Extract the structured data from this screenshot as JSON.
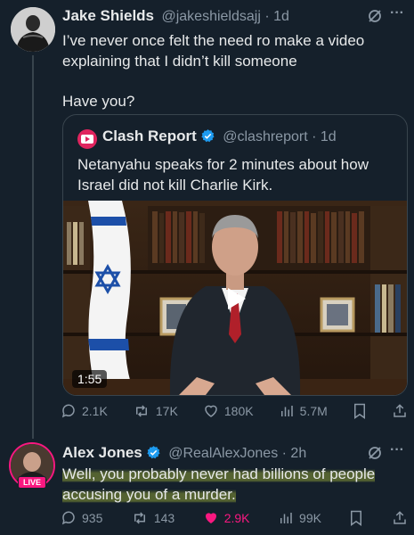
{
  "tweet1": {
    "name": "Jake Shields",
    "handle": "@jakeshieldsajj",
    "time": "· 1d",
    "line1": "I’ve never once felt the need ro make a video",
    "line2": "explaining that I didn’t kill someone",
    "line3": "Have you?",
    "more": "···"
  },
  "quote": {
    "name": "Clash Report",
    "handle": "@clashreport",
    "time": "· 1d",
    "line1": "Netanyahu speaks for 2 minutes about how",
    "line2": "Israel did not kill Charlie Kirk.",
    "duration": "1:55"
  },
  "tweet1_stats": {
    "replies": "2.1K",
    "reposts": "17K",
    "likes": "180K",
    "views": "5.7M"
  },
  "tweet2": {
    "name": "Alex Jones",
    "handle": "@RealAlexJones",
    "time": "· 2h",
    "live_badge": "LIVE",
    "line1": "Well, you probably never had billions of people",
    "line2": "accusing you of a murder.",
    "more": "···"
  },
  "tweet2_stats": {
    "replies": "935",
    "reposts": "143",
    "likes": "2.9K",
    "views": "99K"
  },
  "colors": {
    "background": "#15202b",
    "verified": "#1d9bf0",
    "like_active": "#f91880",
    "muted": "#8b98a5"
  }
}
